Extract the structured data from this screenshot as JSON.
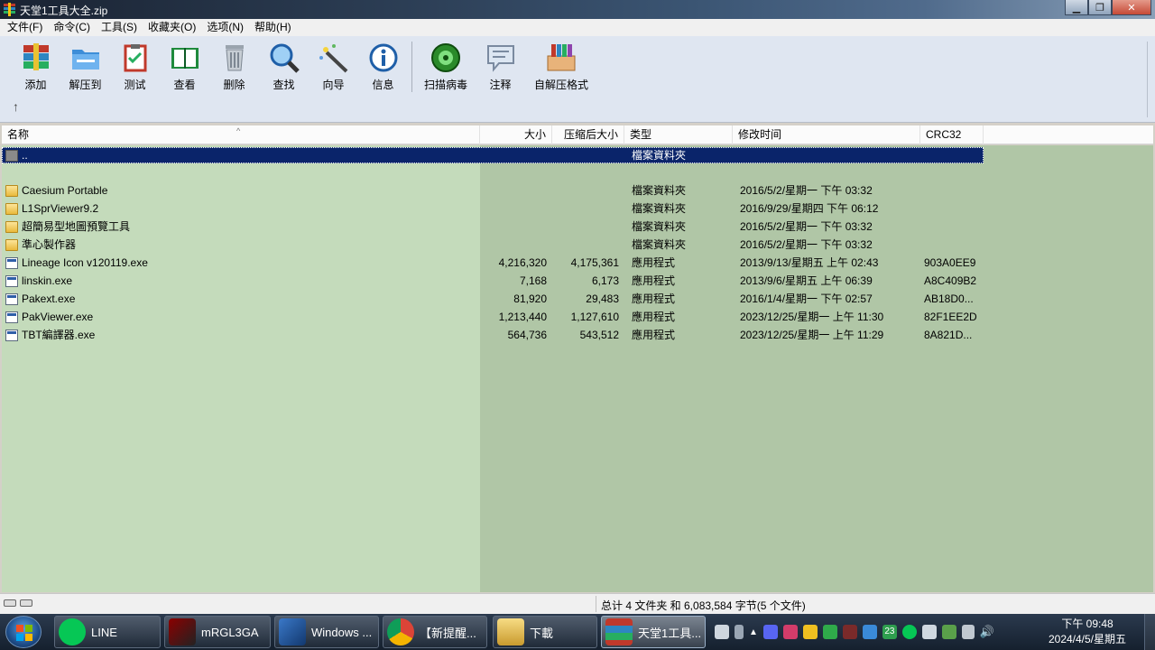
{
  "window": {
    "title": "天堂1工具大全.zip"
  },
  "menu": [
    "文件(F)",
    "命令(C)",
    "工具(S)",
    "收藏夹(O)",
    "选项(N)",
    "帮助(H)"
  ],
  "toolbar": {
    "add": "添加",
    "extract": "解压到",
    "test": "测试",
    "view": "查看",
    "delete": "删除",
    "find": "查找",
    "wizard": "向导",
    "info": "信息",
    "virus": "扫描病毒",
    "comment": "注释",
    "sfx": "自解压格式"
  },
  "columns": {
    "name": "名称",
    "size": "大小",
    "packed": "压缩后大小",
    "type": "类型",
    "modified": "修改时间",
    "crc": "CRC32"
  },
  "files": [
    {
      "icon": "up-folder-icon",
      "name": "..",
      "size": "",
      "packed": "",
      "type": "檔案資料夾",
      "modified": "",
      "crc": "",
      "selected": true
    },
    {
      "icon": "folder-icon",
      "name": "Caesium Portable",
      "size": "",
      "packed": "",
      "type": "檔案資料夾",
      "modified": "2016/5/2/星期一 下午 03:32",
      "crc": ""
    },
    {
      "icon": "folder-icon",
      "name": "L1SprViewer9.2",
      "size": "",
      "packed": "",
      "type": "檔案資料夾",
      "modified": "2016/9/29/星期四 下午 06:12",
      "crc": ""
    },
    {
      "icon": "folder-icon",
      "name": "超簡易型地圖預覽工具",
      "size": "",
      "packed": "",
      "type": "檔案資料夾",
      "modified": "2016/5/2/星期一 下午 03:32",
      "crc": ""
    },
    {
      "icon": "folder-icon",
      "name": "準心製作器",
      "size": "",
      "packed": "",
      "type": "檔案資料夾",
      "modified": "2016/5/2/星期一 下午 03:32",
      "crc": ""
    },
    {
      "icon": "exe-icon",
      "name": "Lineage Icon v120119.exe",
      "size": "4,216,320",
      "packed": "4,175,361",
      "type": "應用程式",
      "modified": "2013/9/13/星期五 上午 02:43",
      "crc": "903A0EE9"
    },
    {
      "icon": "exe-icon",
      "name": "linskin.exe",
      "size": "7,168",
      "packed": "6,173",
      "type": "應用程式",
      "modified": "2013/9/6/星期五 上午 06:39",
      "crc": "A8C409B2"
    },
    {
      "icon": "exe-icon",
      "name": "Pakext.exe",
      "size": "81,920",
      "packed": "29,483",
      "type": "應用程式",
      "modified": "2016/1/4/星期一 下午 02:57",
      "crc": "AB18D0..."
    },
    {
      "icon": "exe-icon",
      "name": "PakViewer.exe",
      "size": "1,213,440",
      "packed": "1,127,610",
      "type": "應用程式",
      "modified": "2023/12/25/星期一 上午 11:30",
      "crc": "82F1EE2D"
    },
    {
      "icon": "exe-icon",
      "name": "TBT編譯器.exe",
      "size": "564,736",
      "packed": "543,512",
      "type": "應用程式",
      "modified": "2023/12/25/星期一 上午 11:29",
      "crc": "8A821D..."
    }
  ],
  "status": {
    "summary": "总计 4 文件夹 和 6,083,584 字节(5 个文件)"
  },
  "taskbar": {
    "items": [
      "LINE",
      "mRGL3GA",
      "Windows ...",
      "【新提醒...",
      "下載",
      "天堂1工具..."
    ],
    "tray_number": "23",
    "clock_time": "下午 09:48",
    "clock_date": "2024/4/5/星期五"
  },
  "colors": {
    "selection": "#0a246a",
    "list_bg": "#b0c6a6",
    "name_col_bg": "#c4dbbb",
    "toolbar_bg": "#dfe6f1"
  }
}
